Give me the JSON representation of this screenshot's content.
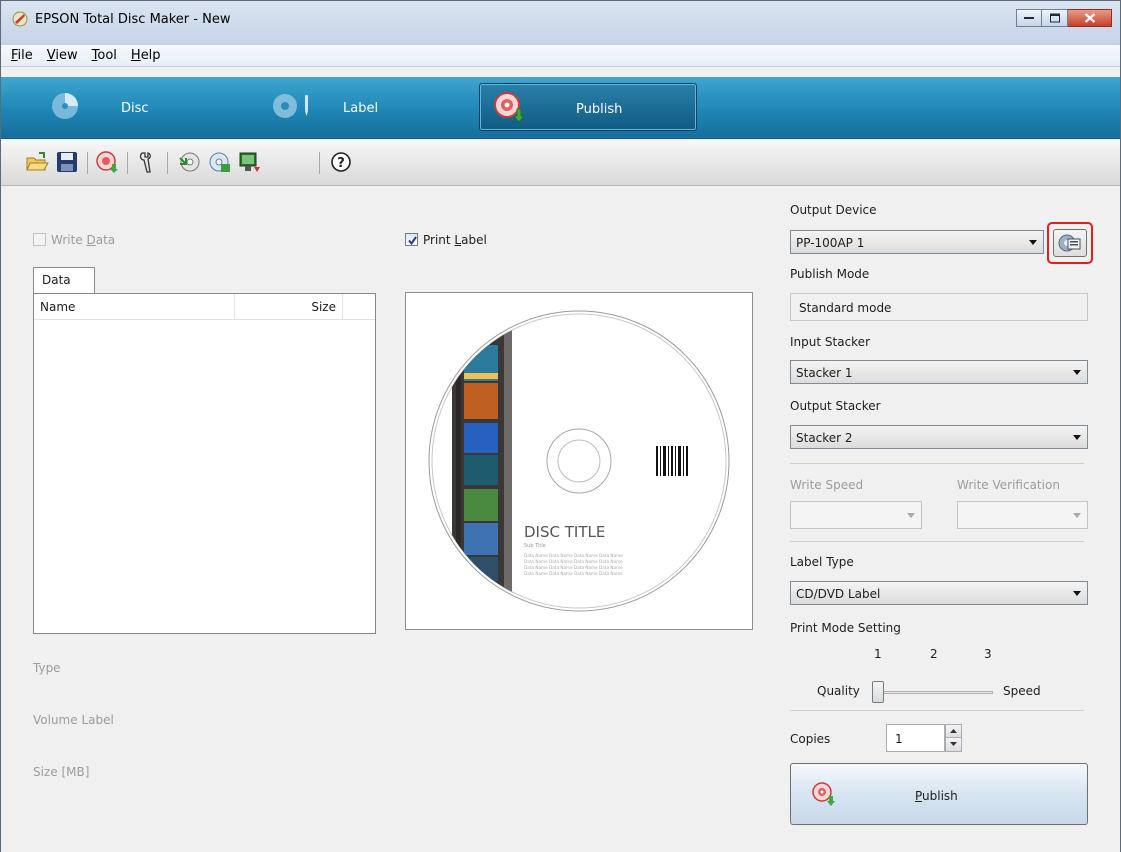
{
  "window": {
    "title": "EPSON Total Disc Maker - New"
  },
  "menu": [
    {
      "prefix": "",
      "accel": "F",
      "rest": "ile"
    },
    {
      "prefix": "",
      "accel": "V",
      "rest": "iew"
    },
    {
      "prefix": "",
      "accel": "T",
      "rest": "ool"
    },
    {
      "prefix": "",
      "accel": "H",
      "rest": "elp"
    }
  ],
  "modes": {
    "disc": "Disc",
    "label": "Label",
    "publish": "Publish",
    "active": "publish"
  },
  "toolbar": {
    "icons": [
      "open-folder-icon",
      "save-icon",
      "publish-disc-icon",
      "tools-icon",
      "import-icon",
      "export-icon",
      "device-icon",
      "help-icon"
    ]
  },
  "left": {
    "write_data": {
      "prefix": "Write ",
      "accel": "D",
      "rest": "ata",
      "checked": false,
      "enabled": false
    },
    "data_tab": "Data",
    "columns": [
      "Name",
      "Size"
    ],
    "type_label": "Type",
    "volume_label": "Volume Label",
    "size_label": "Size [MB]"
  },
  "center": {
    "print_label": {
      "prefix": "Print ",
      "accel": "L",
      "rest": "abel",
      "checked": true
    },
    "disc_title": "DISC TITLE",
    "sub_title": "Sub Title",
    "data_lines": [
      "Data Name Data Name Data Name Data Name",
      "Data Name Data Name Data Name Data Name",
      "Data Name Data Name Data Name Data Name",
      "Data Name Data Name Data Name Data Name"
    ]
  },
  "right": {
    "output_device_label": "Output Device",
    "output_device_value": "PP-100AP 1",
    "publish_mode_label": "Publish Mode",
    "publish_mode_value": "Standard mode",
    "input_stacker_label": "Input Stacker",
    "input_stacker_value": "Stacker 1",
    "output_stacker_label": "Output Stacker",
    "output_stacker_value": "Stacker 2",
    "write_speed_label": "Write Speed",
    "write_verification_label": "Write Verification",
    "label_type_label": "Label Type",
    "label_type_value": "CD/DVD Label",
    "print_mode_label": "Print Mode Setting",
    "print_mode_ticks": [
      "1",
      "2",
      "3"
    ],
    "print_mode_quality": "Quality",
    "print_mode_speed": "Speed",
    "print_mode_value": 1,
    "copies_label": "Copies",
    "copies_value": "1",
    "publish_button": {
      "prefix": "",
      "accel": "P",
      "rest": "ublish"
    }
  },
  "colors": {
    "accent_blue": "#1f86b6",
    "highlight_red": "#e0201a"
  }
}
